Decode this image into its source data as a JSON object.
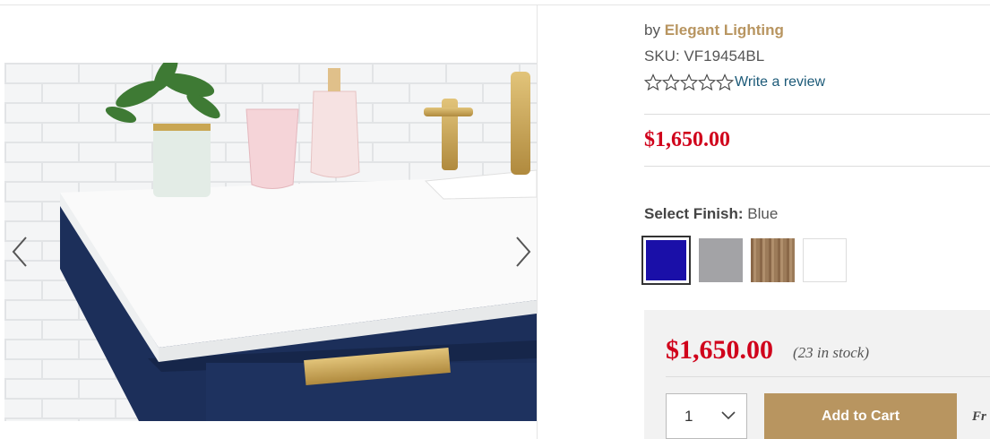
{
  "product": {
    "by_prefix": "by",
    "brand": "Elegant Lighting",
    "sku": "SKU: VF19454BL",
    "rating": {
      "stars": 0,
      "max": 5,
      "review_link": "Write a review"
    },
    "price": "$1,650.00"
  },
  "finish": {
    "label": "Select Finish:",
    "selected": "Blue",
    "swatches": [
      {
        "color": "#1a0fa8",
        "selected": true
      },
      {
        "color": "#a3a3a6",
        "selected": false
      },
      {
        "color": "#9a7a5a",
        "selected": false
      },
      {
        "color": "#ffffff",
        "selected": false
      }
    ]
  },
  "cart": {
    "price": "$1,650.00",
    "stock": "(23 in stock)",
    "quantity": "1",
    "add_button": "Add to Cart",
    "side_text": "Fr"
  },
  "gallery": {
    "icons": [
      "chevron-left-icon",
      "chevron-right-icon"
    ]
  }
}
